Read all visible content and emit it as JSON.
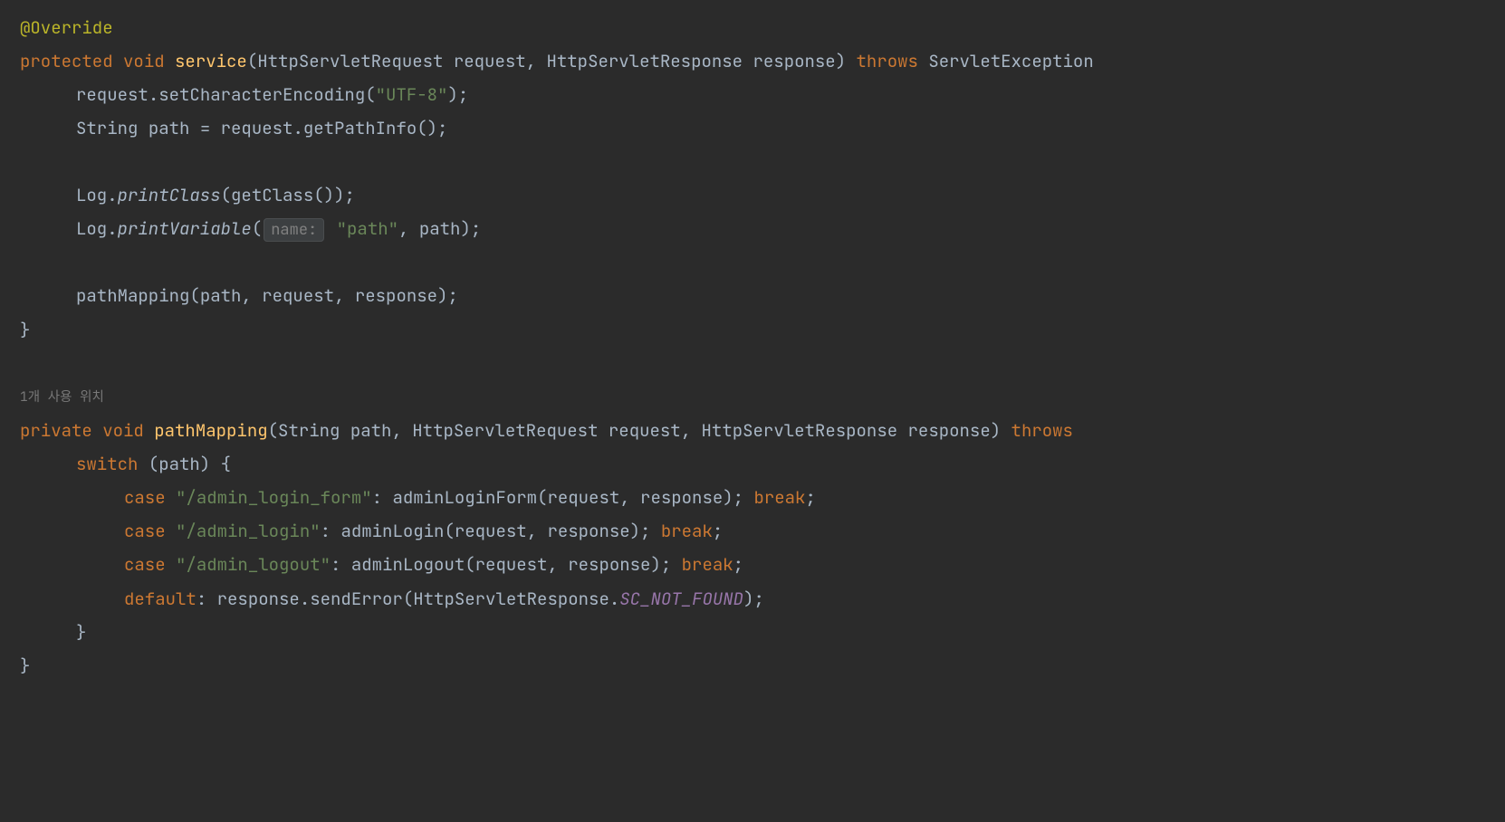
{
  "l1": {
    "annotation": "@Override"
  },
  "l2": {
    "kw_protected": "protected",
    "kw_void": "void",
    "method": "service",
    "p_open": "(",
    "t1": "HttpServletRequest ",
    "a1": "request",
    "c1": ", ",
    "t2": "HttpServletResponse ",
    "a2": "response",
    "p_close": ") ",
    "kw_throws": "throws",
    "ex": " ServletException"
  },
  "l3": {
    "obj": "request",
    "dot": ".",
    "m": "setCharacterEncoding",
    "open": "(",
    "str": "\"UTF-8\"",
    "close": ");"
  },
  "l4": {
    "t": "String ",
    "v": "path",
    "eq": " = ",
    "obj": "request",
    "dot": ".",
    "m": "getPathInfo",
    "rest": "();"
  },
  "l6": {
    "cls": "Log",
    "dot": ".",
    "m": "printClass",
    "open": "(",
    "inner": "getClass()",
    "close": ");"
  },
  "l7": {
    "cls": "Log",
    "dot": ".",
    "m": "printVariable",
    "open": "(",
    "hint": "name:",
    "sp1": " ",
    "str": "\"path\"",
    "c": ", ",
    "v": "path",
    "close": ");"
  },
  "l9": {
    "m": "pathMapping",
    "open": "(",
    "a1": "path",
    "c1": ", ",
    "a2": "request",
    "c2": ", ",
    "a3": "response",
    "close": ");"
  },
  "l10": {
    "brace": "}"
  },
  "usage": "1개 사용 위치",
  "l12": {
    "kw_private": "private",
    "kw_void": "void",
    "method": "pathMapping",
    "open": "(",
    "t1": "String ",
    "a1": "path",
    "c1": ", ",
    "t2": "HttpServletRequest ",
    "a2": "request",
    "c2": ", ",
    "t3": "HttpServletResponse ",
    "a3": "response",
    "close": ") ",
    "kw_throws": "throws"
  },
  "l13": {
    "kw": "switch",
    "rest": " (path) {"
  },
  "l14": {
    "kw": "case",
    "sp": " ",
    "str": "\"/admin_login_form\"",
    "colon": ": ",
    "m": "adminLoginForm",
    "args": "(request, response); ",
    "br": "break",
    "semi": ";"
  },
  "l15": {
    "kw": "case",
    "sp": " ",
    "str": "\"/admin_login\"",
    "colon": ": ",
    "m": "adminLogin",
    "args": "(request, response); ",
    "br": "break",
    "semi": ";"
  },
  "l16": {
    "kw": "case",
    "sp": " ",
    "str": "\"/admin_logout\"",
    "colon": ": ",
    "m": "adminLogout",
    "args": "(request, response); ",
    "br": "break",
    "semi": ";"
  },
  "l17": {
    "kw": "default",
    "colon": ": ",
    "obj": "response",
    "dot": ".",
    "m": "sendError",
    "open": "(",
    "cls": "HttpServletResponse",
    "dot2": ".",
    "const": "SC_NOT_FOUND",
    "close": ");"
  },
  "l18": {
    "brace": "}"
  },
  "l19": {
    "brace": "}"
  }
}
